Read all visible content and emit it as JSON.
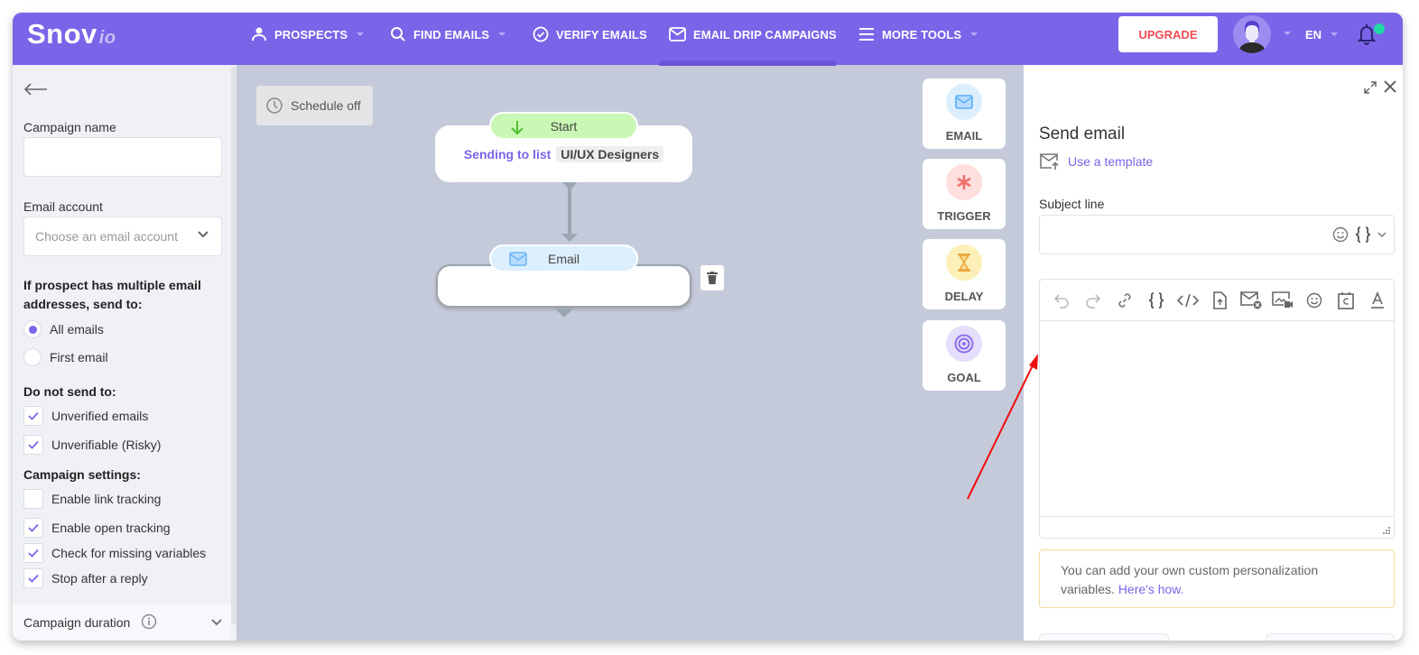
{
  "nav": {
    "logo_main": "Snov",
    "logo_suffix": "io",
    "items": [
      {
        "label": "PROSPECTS",
        "icon": "user-icon",
        "has_dropdown": true
      },
      {
        "label": "FIND EMAILS",
        "icon": "search-icon",
        "has_dropdown": true
      },
      {
        "label": "VERIFY EMAILS",
        "icon": "check-circle-icon",
        "has_dropdown": false
      },
      {
        "label": "EMAIL DRIP CAMPAIGNS",
        "icon": "envelope-icon",
        "has_dropdown": false,
        "active": true
      },
      {
        "label": "MORE TOOLS",
        "icon": "menu-icon",
        "has_dropdown": true
      }
    ],
    "upgrade_label": "UPGRADE",
    "language": "EN",
    "notification_dot": true,
    "colors": {
      "brand": "#7b64e8",
      "upgrade_text": "#f04b55",
      "notif_dot": "#1fd9a3"
    }
  },
  "left_panel": {
    "campaign_name_label": "Campaign name",
    "campaign_name_value": "",
    "email_account_label": "Email account",
    "email_account_placeholder": "Choose an email account",
    "multiple_email_heading": "If prospect has multiple email addresses, send to:",
    "send_to_options": [
      {
        "label": "All emails",
        "selected": true
      },
      {
        "label": "First email",
        "selected": false
      }
    ],
    "do_not_send_heading": "Do not send to:",
    "do_not_send_options": [
      {
        "label": "Unverified emails",
        "checked": true
      },
      {
        "label": "Unverifiable (Risky)",
        "checked": true
      }
    ],
    "campaign_settings_heading": "Campaign settings:",
    "campaign_settings": [
      {
        "label": "Enable link tracking",
        "checked": false
      },
      {
        "label": "Enable open tracking",
        "checked": true
      },
      {
        "label": "Check for missing variables",
        "checked": true
      },
      {
        "label": "Stop after a reply",
        "checked": true
      }
    ],
    "campaign_duration_label": "Campaign duration"
  },
  "canvas": {
    "schedule_label": "Schedule off",
    "start_node": {
      "pill_label": "Start",
      "sending_prefix": "Sending to list",
      "list_name": "UI/UX Designers"
    },
    "email_node": {
      "pill_label": "Email"
    }
  },
  "tools": [
    {
      "label": "EMAIL",
      "icon": "envelope-icon",
      "color": "#dcefff"
    },
    {
      "label": "TRIGGER",
      "icon": "asterisk-icon",
      "color": "#ffdede"
    },
    {
      "label": "DELAY",
      "icon": "hourglass-icon",
      "color": "#fcefb8"
    },
    {
      "label": "GOAL",
      "icon": "target-icon",
      "color": "#e5defd"
    }
  ],
  "right_panel": {
    "title": "Send email",
    "template_link": "Use a template",
    "subject_label": "Subject line",
    "subject_value": "",
    "toolbar": [
      "undo",
      "redo",
      "link",
      "variables",
      "code",
      "attach-file",
      "unsubscribe-link",
      "video",
      "emoji",
      "signature",
      "text-color"
    ],
    "body_value": "",
    "hint_text": "You can add your own custom personalization variables.",
    "hint_link": "Here's how."
  }
}
